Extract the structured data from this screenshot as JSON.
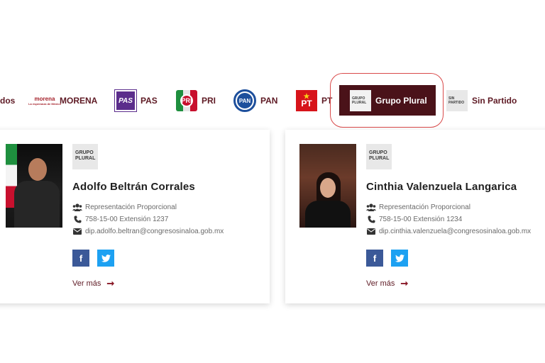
{
  "filter_tabs": [
    {
      "label": "dos"
    },
    {
      "label": "MORENA",
      "logo_text": "morena",
      "logo_sub": "La esperanza de México"
    },
    {
      "label": "PAS",
      "logo_text": "PAS"
    },
    {
      "label": "PRI",
      "logo_text": "PRI"
    },
    {
      "label": "PAN",
      "logo_text": "PAN"
    },
    {
      "label": "PT",
      "logo_text": "PT"
    },
    {
      "label": "Grupo Plural",
      "logo_line1": "GRUPO",
      "logo_line2": "PLURAL",
      "active": true
    },
    {
      "label": "Sin Partido",
      "logo_line1": "SIN",
      "logo_line2": "PARTIDO"
    }
  ],
  "colors": {
    "accent": "#4a1219",
    "link": "#5e1a24",
    "facebook": "#3b5998",
    "twitter": "#1da1f2"
  },
  "cards": [
    {
      "party_badge_line1": "GRUPO",
      "party_badge_line2": "PLURAL",
      "name": "Adolfo Beltrán Corrales",
      "type": "Representación Proporcional",
      "phone": "758-15-00 Extensión 1237",
      "email": "dip.adolfo.beltran@congresosinaloa.gob.mx",
      "facebook_icon": "f",
      "twitter_icon": "twitter-icon",
      "more_label": "Ver más"
    },
    {
      "party_badge_line1": "GRUPO",
      "party_badge_line2": "PLURAL",
      "name": "Cinthia Valenzuela Langarica",
      "type": "Representación Proporcional",
      "phone": "758-15-00 Extensión 1234",
      "email": "dip.cinthia.valenzuela@congresosinaloa.gob.mx",
      "facebook_icon": "f",
      "twitter_icon": "twitter-icon",
      "more_label": "Ver más"
    }
  ]
}
